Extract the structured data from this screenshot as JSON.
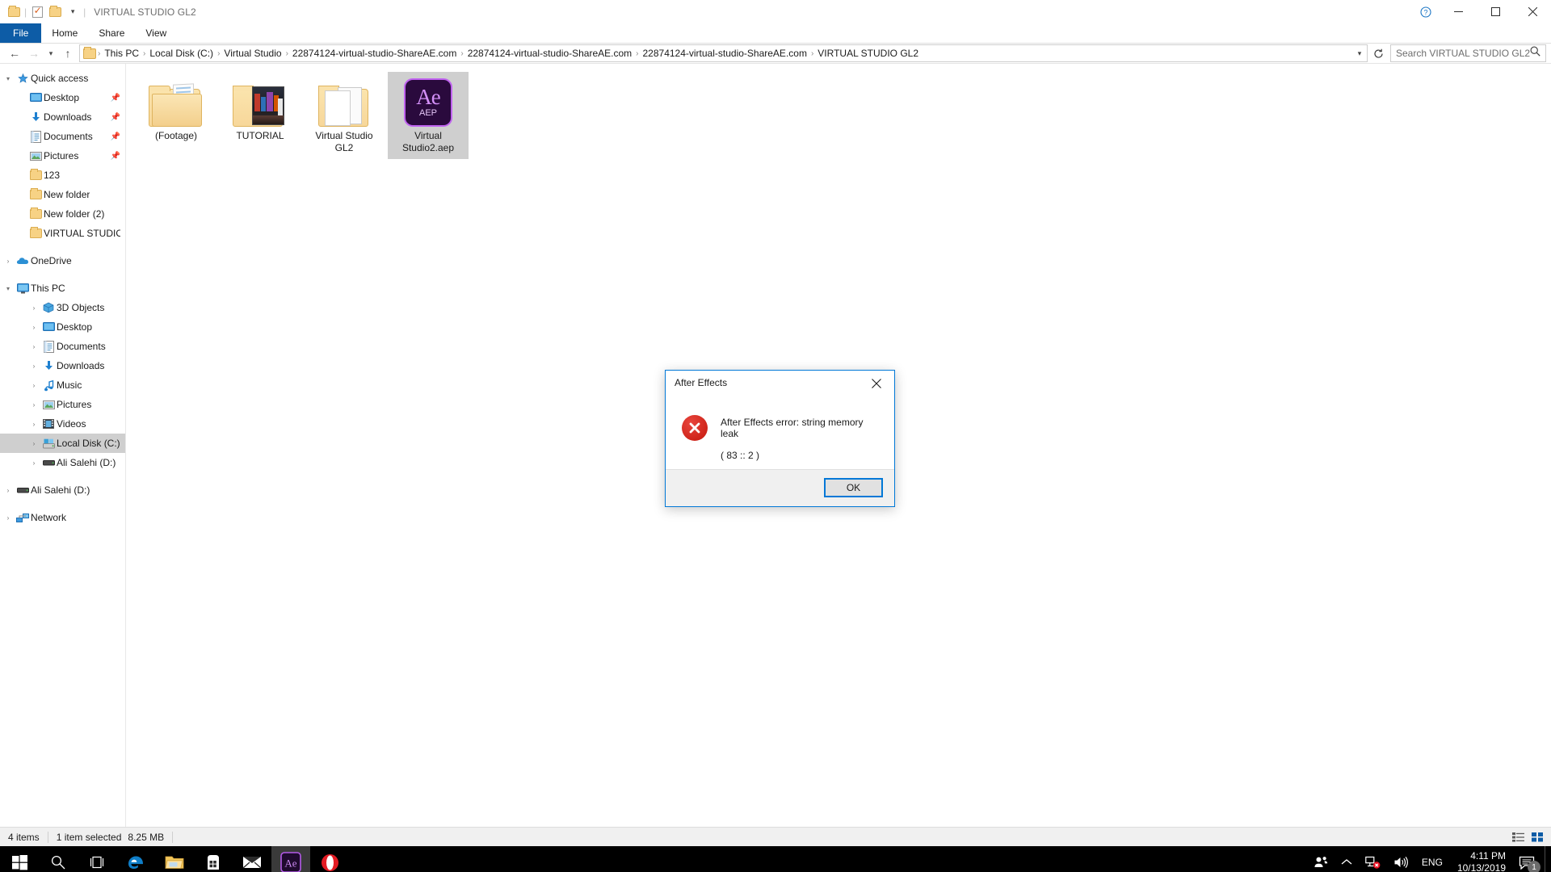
{
  "window": {
    "title": "VIRTUAL STUDIO GL2",
    "quick_access": [
      {
        "name": "folder-icon",
        "label": "Folder"
      },
      {
        "name": "properties-icon",
        "label": "Properties"
      },
      {
        "name": "new-folder-icon",
        "label": "New folder"
      },
      {
        "name": "chevron-down-icon",
        "label": "Customize Quick Access Toolbar"
      }
    ],
    "controls": {
      "minimize": "─",
      "maximize": "❐",
      "close": "✕",
      "help": "?"
    }
  },
  "ribbon": {
    "tabs": [
      {
        "label": "File",
        "active": true
      },
      {
        "label": "Home",
        "active": false
      },
      {
        "label": "Share",
        "active": false
      },
      {
        "label": "View",
        "active": false
      }
    ]
  },
  "addressbar": {
    "back": "←",
    "forward": "→",
    "recent": "⌄",
    "up": "↑",
    "dropdown": "⌄",
    "refresh": "↻",
    "breadcrumbs": [
      "This PC",
      "Local Disk (C:)",
      "Virtual Studio",
      "22874124-virtual-studio-ShareAE.com",
      "22874124-virtual-studio-ShareAE.com",
      "22874124-virtual-studio-ShareAE.com",
      "VIRTUAL STUDIO GL2"
    ],
    "separator": "›"
  },
  "search": {
    "placeholder": "Search VIRTUAL STUDIO GL2",
    "value": "",
    "icon": "search-icon"
  },
  "navpane": {
    "groups": [
      {
        "name": "quick-access",
        "header": {
          "label": "Quick access",
          "expander": "⌄",
          "icon": "star-pin-icon",
          "level": 0
        },
        "items": [
          {
            "label": "Desktop",
            "icon": "desktop-icon",
            "pinned": true,
            "level": 1
          },
          {
            "label": "Downloads",
            "icon": "downloads-icon",
            "pinned": true,
            "level": 1
          },
          {
            "label": "Documents",
            "icon": "documents-icon",
            "pinned": true,
            "level": 1
          },
          {
            "label": "Pictures",
            "icon": "pictures-icon",
            "pinned": true,
            "level": 1
          },
          {
            "label": "123",
            "icon": "folder-icon",
            "pinned": false,
            "level": 1
          },
          {
            "label": "New folder",
            "icon": "folder-icon",
            "pinned": false,
            "level": 1
          },
          {
            "label": "New folder (2)",
            "icon": "folder-icon",
            "pinned": false,
            "level": 1
          },
          {
            "label": "VIRTUAL STUDIO Gl",
            "icon": "folder-icon",
            "pinned": false,
            "level": 1
          }
        ]
      },
      {
        "name": "onedrive",
        "header": {
          "label": "OneDrive",
          "expander": "›",
          "icon": "onedrive-icon",
          "level": 0
        },
        "items": []
      },
      {
        "name": "this-pc",
        "header": {
          "label": "This PC",
          "expander": "⌄",
          "icon": "this-pc-icon",
          "level": 0
        },
        "items": [
          {
            "label": "3D Objects",
            "icon": "3d-objects-icon",
            "expander": "›",
            "level": 1
          },
          {
            "label": "Desktop",
            "icon": "desktop-icon",
            "expander": "›",
            "level": 1
          },
          {
            "label": "Documents",
            "icon": "documents-icon",
            "expander": "›",
            "level": 1
          },
          {
            "label": "Downloads",
            "icon": "downloads-icon",
            "expander": "›",
            "level": 1
          },
          {
            "label": "Music",
            "icon": "music-icon",
            "expander": "›",
            "level": 1
          },
          {
            "label": "Pictures",
            "icon": "pictures-icon",
            "expander": "›",
            "level": 1
          },
          {
            "label": "Videos",
            "icon": "videos-icon",
            "expander": "›",
            "level": 1
          },
          {
            "label": "Local Disk (C:)",
            "icon": "drive-icon",
            "expander": "›",
            "level": 1,
            "selected": true
          },
          {
            "label": "Ali Salehi (D:)",
            "icon": "drive-icon",
            "expander": "›",
            "level": 1
          }
        ]
      },
      {
        "name": "ali-salehi-drive",
        "header": {
          "label": "Ali Salehi (D:)",
          "expander": "›",
          "icon": "drive-icon",
          "level": 0
        },
        "items": []
      },
      {
        "name": "network",
        "header": {
          "label": "Network",
          "expander": "›",
          "icon": "network-icon",
          "level": 0
        },
        "items": []
      }
    ]
  },
  "files": [
    {
      "name": "(Footage)",
      "type": "folder-with-files",
      "selected": false
    },
    {
      "name": "TUTORIAL",
      "type": "folder-with-picture",
      "selected": false
    },
    {
      "name": "Virtual Studio GL2",
      "type": "folder-white",
      "selected": false
    },
    {
      "name": "Virtual Studio2.aep",
      "type": "after-effects-project",
      "selected": true,
      "badge": "AEP",
      "logo": "Ae"
    }
  ],
  "statusbar": {
    "item_count": "4 items",
    "selection": "1 item selected",
    "size": "8.25 MB",
    "views": [
      {
        "name": "details-view-icon",
        "glyph": "☰",
        "active": false
      },
      {
        "name": "large-icons-view-icon",
        "glyph": "▦",
        "active": true
      }
    ]
  },
  "dialog": {
    "title": "After Effects",
    "close": "✕",
    "icon": "error-icon",
    "message": "After Effects error: string memory leak",
    "code": "( 83 :: 2 )",
    "ok_label": "OK",
    "accent_color": "#0078d7",
    "error_color": "#c5170d"
  },
  "taskbar": {
    "items": [
      {
        "name": "start-button",
        "label": "Start",
        "running": false
      },
      {
        "name": "search-taskbar-button",
        "label": "Search",
        "running": false
      },
      {
        "name": "task-view-button",
        "label": "Task View",
        "running": false
      },
      {
        "name": "edge-taskbar-icon",
        "label": "Microsoft Edge",
        "running": false
      },
      {
        "name": "file-explorer-taskbar-icon",
        "label": "File Explorer",
        "running": true
      },
      {
        "name": "store-taskbar-icon",
        "label": "Microsoft Store",
        "running": false
      },
      {
        "name": "mail-taskbar-icon",
        "label": "Mail",
        "running": false
      },
      {
        "name": "after-effects-taskbar-icon",
        "label": "Adobe After Effects",
        "running": true,
        "active": true
      },
      {
        "name": "opera-taskbar-icon",
        "label": "Opera",
        "running": false
      }
    ],
    "tray": {
      "people": "people-icon",
      "chevron": "⌃",
      "network": "network-error-icon",
      "volume": "volume-icon",
      "language": "ENG",
      "time": "4:11 PM",
      "date": "10/13/2019",
      "notification_count": "1"
    }
  }
}
